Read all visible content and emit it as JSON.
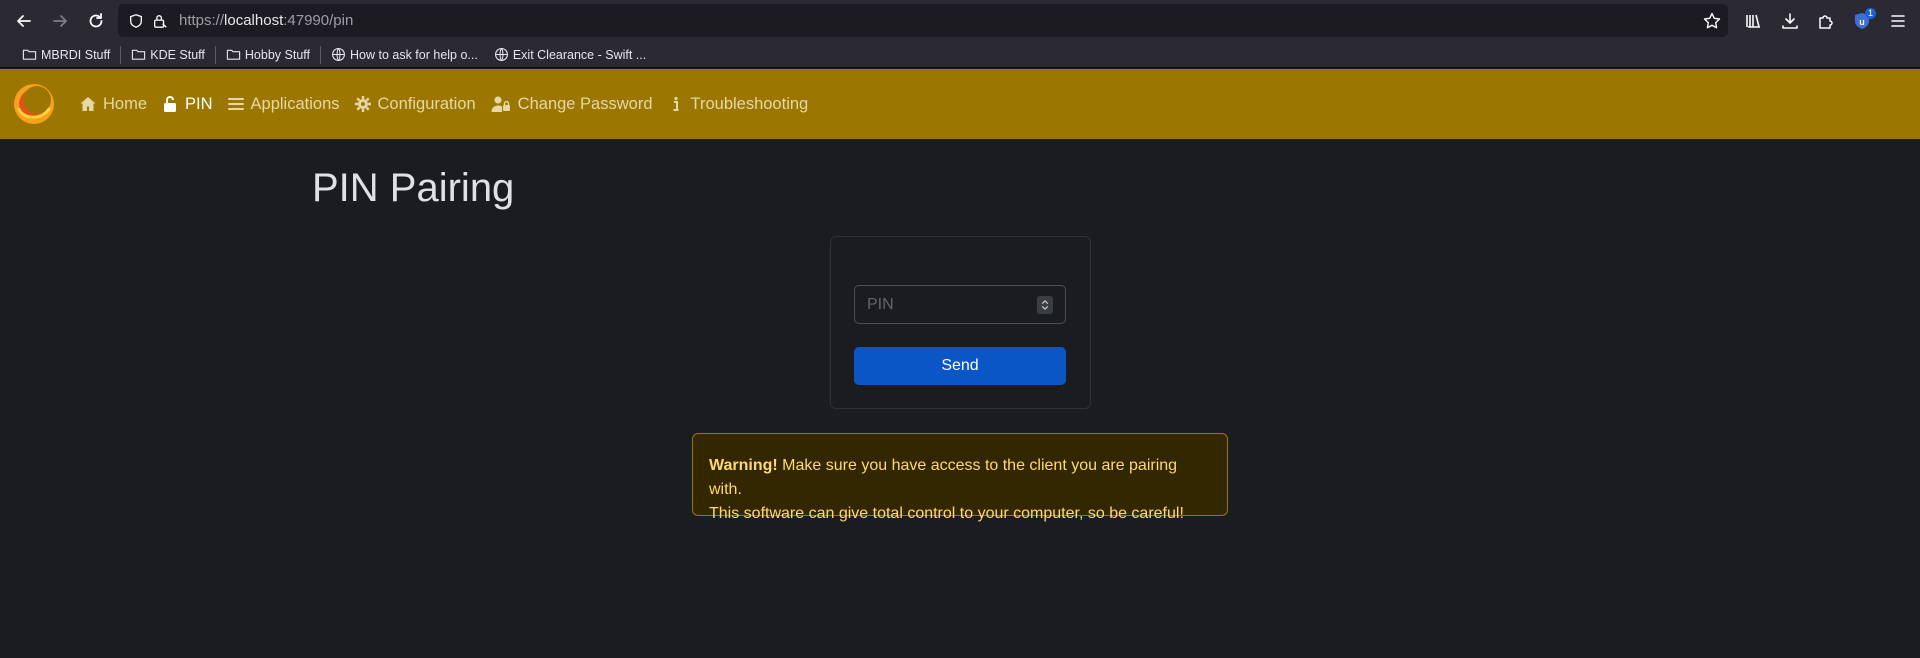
{
  "browser": {
    "url_scheme": "https://",
    "url_host": "localhost",
    "url_path": ":47990/pin",
    "extension_badge": "1"
  },
  "bookmarks": [
    {
      "label": "MBRDI Stuff",
      "icon": "folder-icon"
    },
    {
      "label": "KDE Stuff",
      "icon": "folder-icon"
    },
    {
      "label": "Hobby Stuff",
      "icon": "folder-icon"
    },
    {
      "label": "How to ask for help o...",
      "icon": "globe-icon"
    },
    {
      "label": "Exit Clearance - Swift ...",
      "icon": "globe-icon"
    }
  ],
  "navbar": {
    "items": [
      {
        "label": "Home",
        "icon": "home-icon"
      },
      {
        "label": "PIN",
        "icon": "unlock-icon",
        "active": true
      },
      {
        "label": "Applications",
        "icon": "list-icon"
      },
      {
        "label": "Configuration",
        "icon": "gear-icon"
      },
      {
        "label": "Change Password",
        "icon": "user-lock-icon"
      },
      {
        "label": "Troubleshooting",
        "icon": "info-icon"
      }
    ]
  },
  "main": {
    "title": "PIN Pairing",
    "pin_placeholder": "PIN",
    "send_label": "Send",
    "warning_strong": "Warning!",
    "warning_line1": " Make sure you have access to the client you are pairing with.",
    "warning_line2": "This software can give total control to your computer, so be careful!"
  },
  "colors": {
    "navbar_bg": "#9b7600",
    "page_bg": "#1b1c1f",
    "send_button": "#0b56c6",
    "warning_bg": "#332701",
    "warning_text": "#ffda6a"
  }
}
